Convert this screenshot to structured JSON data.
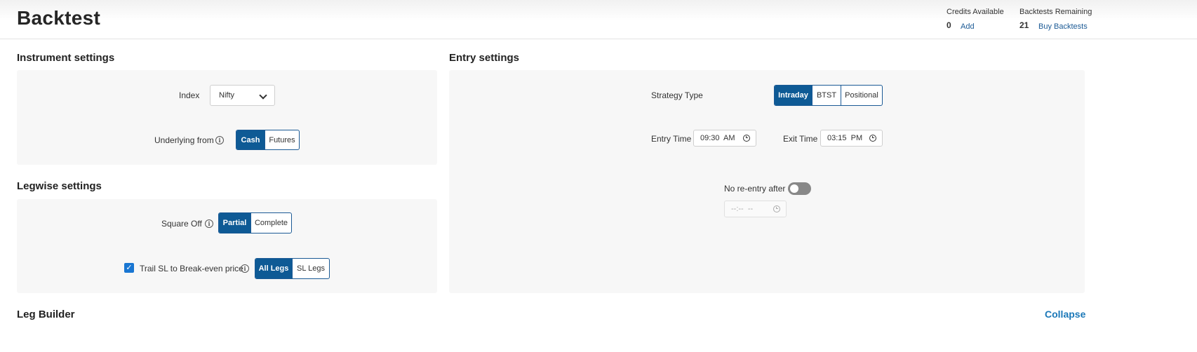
{
  "header": {
    "title": "Backtest",
    "credits": {
      "label": "Credits Available",
      "value": "0",
      "link": "Add"
    },
    "backtests": {
      "label": "Backtests Remaining",
      "value": "21",
      "link": "Buy Backtests"
    }
  },
  "instrument": {
    "title": "Instrument settings",
    "index_label": "Index",
    "index_value": "Nifty",
    "underlying_label": "Underlying from",
    "underlying_options": [
      "Cash",
      "Futures"
    ],
    "underlying_selected": "Cash"
  },
  "legwise": {
    "title": "Legwise settings",
    "square_off_label": "Square Off",
    "square_off_options": [
      "Partial",
      "Complete"
    ],
    "square_off_selected": "Partial",
    "trail_label": "Trail SL to Break-even price",
    "trail_checked": true,
    "trail_options": [
      "All Legs",
      "SL Legs"
    ],
    "trail_selected": "All Legs"
  },
  "entry": {
    "title": "Entry settings",
    "strategy_label": "Strategy Type",
    "strategy_options": [
      "Intraday",
      "BTST",
      "Positional"
    ],
    "strategy_selected": "Intraday",
    "entry_time_label": "Entry Time",
    "entry_time_value": "09:30  AM",
    "exit_time_label": "Exit Time",
    "exit_time_value": "03:15  PM",
    "no_reentry_label": "No re-entry after",
    "no_reentry_enabled": false,
    "no_reentry_placeholder": "--:--  --"
  },
  "leg_builder": {
    "title": "Leg Builder",
    "collapse_label": "Collapse"
  },
  "colors": {
    "primary": "#0e5a95",
    "link": "#1b78b8",
    "panel": "#f7f7f7"
  },
  "icons": [
    "info-icon",
    "chevron-down-icon",
    "clock-icon",
    "check-icon"
  ]
}
